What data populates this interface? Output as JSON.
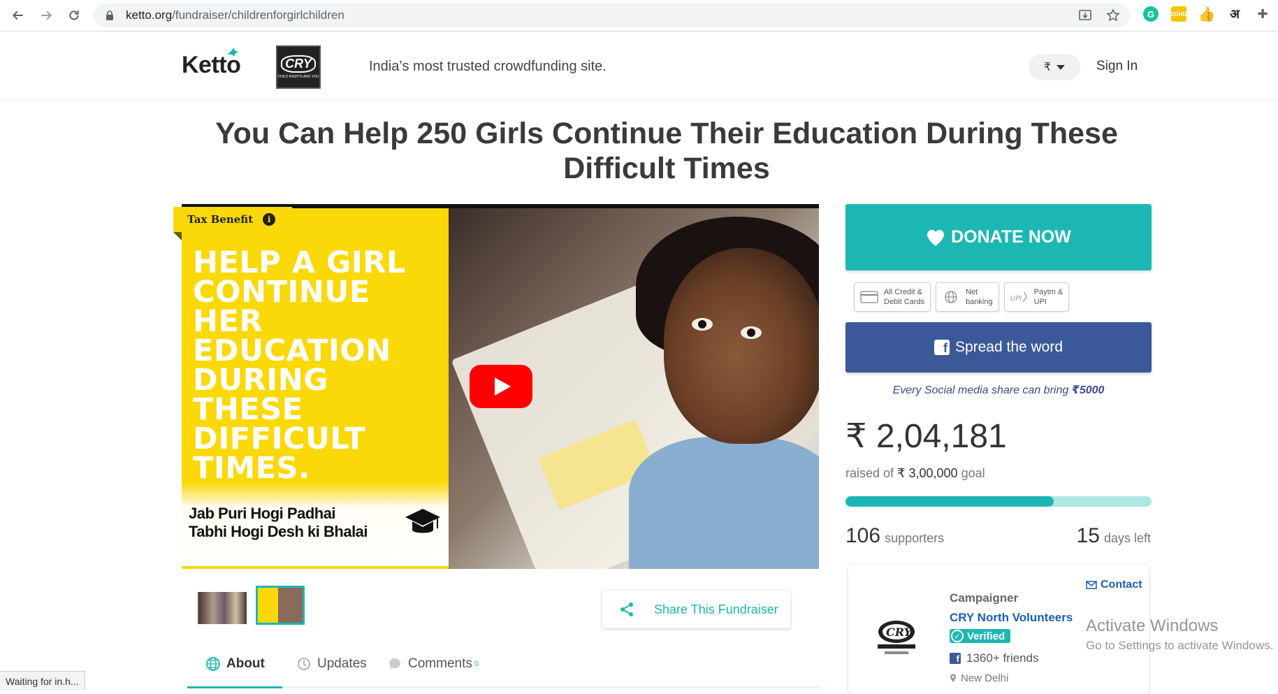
{
  "browser": {
    "url_host": "ketto.org",
    "url_path": "/fundraiser/childrenforgirlchildren",
    "ext_hindi": "अ",
    "status_text": "Waiting for in.h..."
  },
  "header": {
    "logo_text": "Ketto",
    "tagline": "India’s most trusted crowdfunding site.",
    "currency": "₹",
    "signin_label": "Sign In"
  },
  "page": {
    "title": "You Can Help 250 Girls Continue Their Education During These Difficult Times"
  },
  "media": {
    "tax_badge": "Tax Benefit",
    "headline": "HELP A GIRL CONTINUE HER EDUCATION DURING THESE DIFFICULT TIMES.",
    "footer_line1": "Jab Puri Hogi Padhai",
    "footer_line2": "Tabhi Hogi Desh ki Bhalai"
  },
  "share": {
    "label": "Share This Fundraiser"
  },
  "tabs": {
    "about": "About",
    "updates": "Updates",
    "comments": "Comments",
    "comments_count": "0"
  },
  "donate": {
    "label": "DONATE NOW",
    "pay_options": [
      {
        "line1": "All Credit &",
        "line2": "Debit Cards",
        "icon": "card-icon"
      },
      {
        "line1": "Net",
        "line2": "banking",
        "icon": "globe-icon"
      },
      {
        "line1": "Paytm &",
        "line2": "UPI",
        "icon": "upi-icon"
      }
    ],
    "spread_label": "Spread the word",
    "share_note": "Every Social media share can bring ",
    "share_note_amount": "₹5000"
  },
  "stats": {
    "raised": "₹ 2,04,181",
    "raised_prefix": "raised of ",
    "goal": "₹ 3,00,000",
    "goal_suffix": " goal",
    "progress_percent": 68,
    "supporters": "106",
    "supporters_label": "supporters",
    "days": "15",
    "days_label": "days left"
  },
  "campaigner": {
    "contact_label": "Contact",
    "label": "Campaigner",
    "name": "CRY North Volunteers",
    "verified": "Verified",
    "friends": "1360+ friends",
    "location": "New Delhi"
  },
  "watermark": {
    "line1": "Activate Windows",
    "line2": "Go to Settings to activate Windows."
  },
  "colors": {
    "accent": "#1db7b3",
    "facebook": "#3b5998",
    "media_yellow": "#fbd808"
  }
}
